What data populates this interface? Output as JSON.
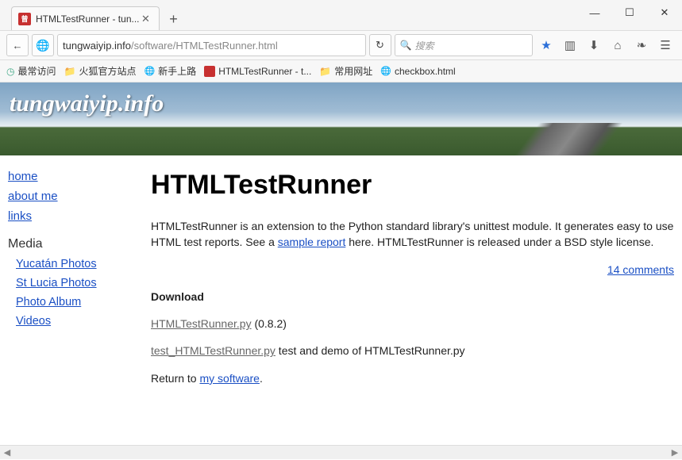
{
  "window": {
    "tab_title": "HTMLTestRunner - tun..."
  },
  "nav": {
    "url_host": "tungwaiyip.info",
    "url_path": "/software/HTMLTestRunner.html",
    "search_placeholder": "搜索"
  },
  "bookmarks": [
    {
      "label": "最常访问",
      "type": "sys"
    },
    {
      "label": "火狐官方站点",
      "type": "folder"
    },
    {
      "label": "新手上路",
      "type": "globe"
    },
    {
      "label": "HTMLTestRunner - t...",
      "type": "fav"
    },
    {
      "label": "常用网址",
      "type": "folder"
    },
    {
      "label": "checkbox.html",
      "type": "globe"
    }
  ],
  "banner": {
    "title": "tungwaiyip.info"
  },
  "sidebar": {
    "links": [
      "home",
      "about me",
      "links"
    ],
    "media_heading": "Media",
    "media_links": [
      "Yucatán Photos",
      "St Lucia Photos",
      "Photo Album",
      "Videos"
    ]
  },
  "content": {
    "h1": "HTMLTestRunner",
    "intro_1": "HTMLTestRunner is an extension to the Python standard library's unittest module. It generates easy to use HTML test reports. See a ",
    "intro_link": "sample report",
    "intro_2": " here. HTMLTestRunner is released under a BSD style license.",
    "comments": "14 comments",
    "download_h": "Download",
    "dl1_link": "HTMLTestRunner.py",
    "dl1_ver": " (0.8.2)",
    "dl2_link": "test_HTMLTestRunner.py",
    "dl2_txt": " test and demo of HTMLTestRunner.py",
    "return_1": "Return to ",
    "return_link": "my software",
    "return_2": "."
  }
}
